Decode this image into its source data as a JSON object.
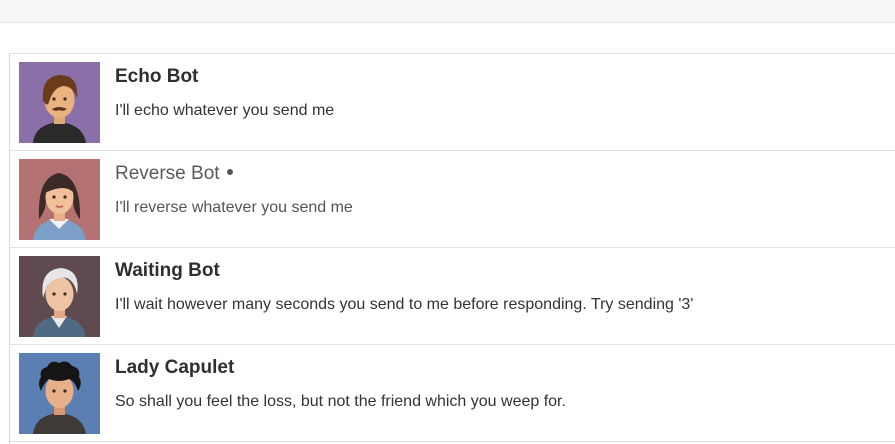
{
  "conversations": [
    {
      "name": "Echo Bot",
      "last_message": "I'll echo whatever you send me",
      "avatar": "man-with-mustache-avatar",
      "avatar_bg": "#8a6fa8",
      "unread": false
    },
    {
      "name": "Reverse Bot",
      "last_message": "I'll reverse whatever you send me",
      "avatar": "woman-avatar",
      "avatar_bg": "#b47272",
      "unread": true
    },
    {
      "name": "Waiting Bot",
      "last_message": "I'll wait however many seconds you send to me before responding. Try sending '3'",
      "avatar": "old-man-avatar",
      "avatar_bg": "#5e4a4f",
      "unread": false
    },
    {
      "name": "Lady Capulet",
      "last_message": "So shall you feel the loss, but not the friend which you weep for.",
      "avatar": "curly-hair-avatar",
      "avatar_bg": "#5c7fb3",
      "unread": false
    }
  ],
  "colors": {
    "text": "#2f2f2f",
    "unread_text": "#5a5a5a",
    "divider": "#e2e2e2"
  }
}
